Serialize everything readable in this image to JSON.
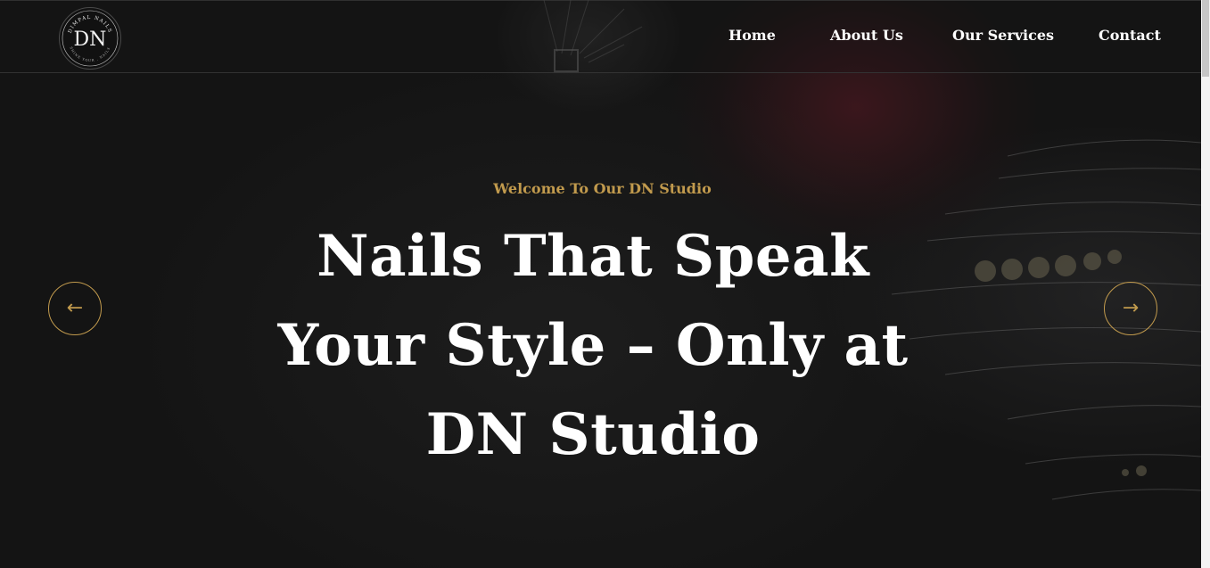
{
  "logo": {
    "monogram": "DN",
    "ring_top": "DIMPAL NAILS",
    "ring_bottom": "SHINE YOUR . NAILS"
  },
  "nav": {
    "items": [
      {
        "label": "Home"
      },
      {
        "label": "About Us"
      },
      {
        "label": "Our Services"
      },
      {
        "label": "Contact"
      }
    ]
  },
  "hero": {
    "subtitle": "Welcome To Our DN Studio",
    "title": "Nails That Speak Your Style – Only at DN Studio"
  },
  "carousel": {
    "prev_icon": "arrow-left-icon",
    "next_icon": "arrow-right-icon",
    "prev_glyph": "←",
    "next_glyph": "→"
  },
  "colors": {
    "accent": "#c19a4d",
    "text": "#ffffff",
    "background": "#151515"
  }
}
